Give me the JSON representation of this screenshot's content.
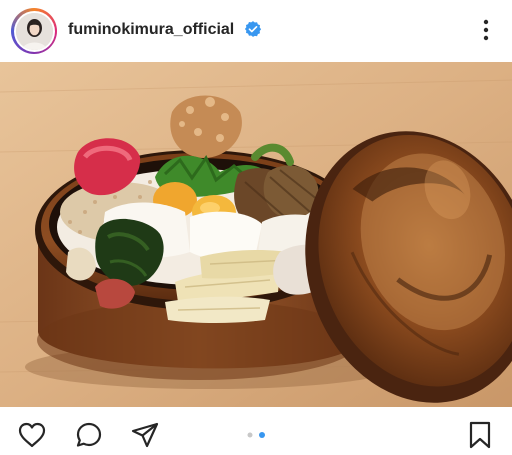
{
  "post": {
    "username": "fuminokimura_official",
    "verified": true,
    "media_count": 2,
    "active_media_index": 2
  },
  "icons": {
    "avatar": "profile-avatar",
    "verified": "verified-badge-icon",
    "more": "more-options-icon",
    "like": "heart-icon",
    "comment": "comment-bubble-icon",
    "share": "paper-plane-icon",
    "save": "bookmark-icon"
  },
  "colors": {
    "verified_blue": "#3897f0",
    "active_dot": "#3897f0",
    "inactive_dot": "#c8c8c8",
    "text": "#262626"
  }
}
